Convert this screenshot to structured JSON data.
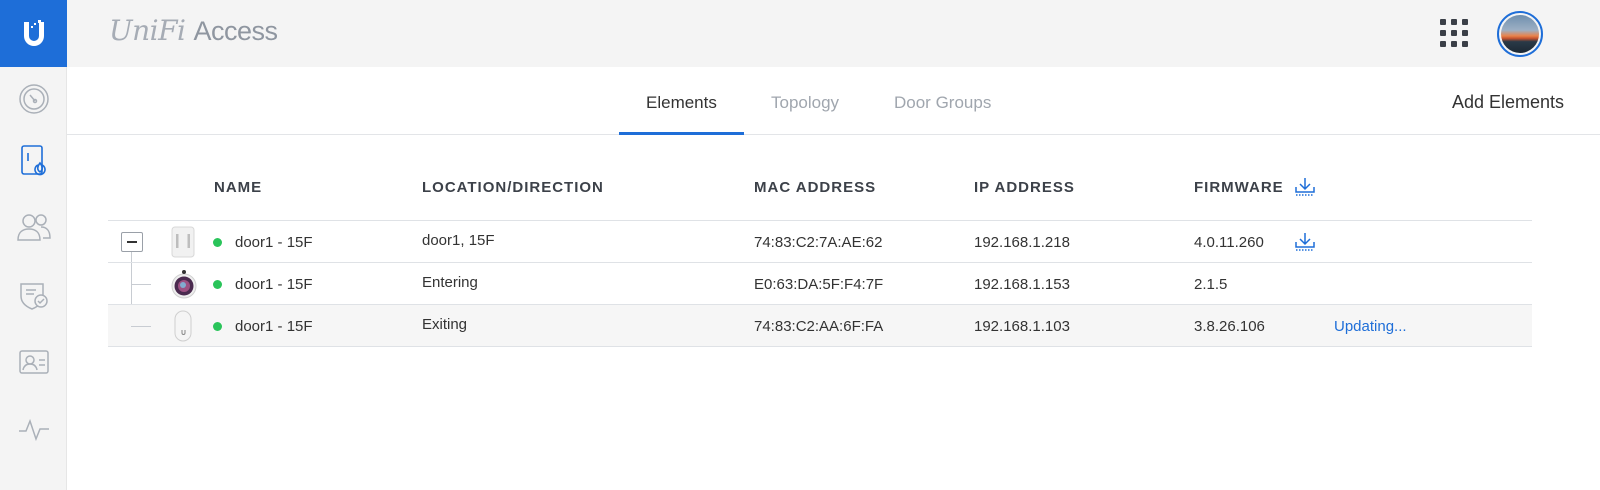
{
  "app": {
    "brand": "UniFi",
    "product": "Access"
  },
  "nav": {
    "items": [
      {
        "icon": "dashboard-icon"
      },
      {
        "icon": "doors-icon",
        "active": true
      },
      {
        "icon": "users-icon"
      },
      {
        "icon": "access-policy-icon"
      },
      {
        "icon": "id-card-icon"
      },
      {
        "icon": "activity-icon"
      }
    ]
  },
  "tabs": [
    {
      "label": "Elements",
      "active": true
    },
    {
      "label": "Topology"
    },
    {
      "label": "Door Groups"
    }
  ],
  "actions": {
    "add_elements": "Add Elements"
  },
  "table": {
    "columns": {
      "name": "NAME",
      "location": "LOCATION/DIRECTION",
      "mac": "MAC ADDRESS",
      "ip": "IP ADDRESS",
      "firmware": "FIRMWARE"
    },
    "rows": [
      {
        "name": "door1 - 15F",
        "location": "door1, 15F",
        "mac": "74:83:C2:7A:AE:62",
        "ip": "192.168.1.218",
        "firmware": "4.0.11.260",
        "status": "online"
      },
      {
        "name": "door1 - 15F",
        "location": "Entering",
        "mac": "E0:63:DA:5F:F4:7F",
        "ip": "192.168.1.153",
        "firmware": "2.1.5",
        "status": "online"
      },
      {
        "name": "door1 - 15F",
        "location": "Exiting",
        "mac": "74:83:C2:AA:6F:FA",
        "ip": "192.168.1.103",
        "firmware": "3.8.26.106",
        "status": "online",
        "update_status": "Updating..."
      }
    ]
  },
  "colors": {
    "accent": "#1e6ed8",
    "online": "#2ac45a"
  }
}
